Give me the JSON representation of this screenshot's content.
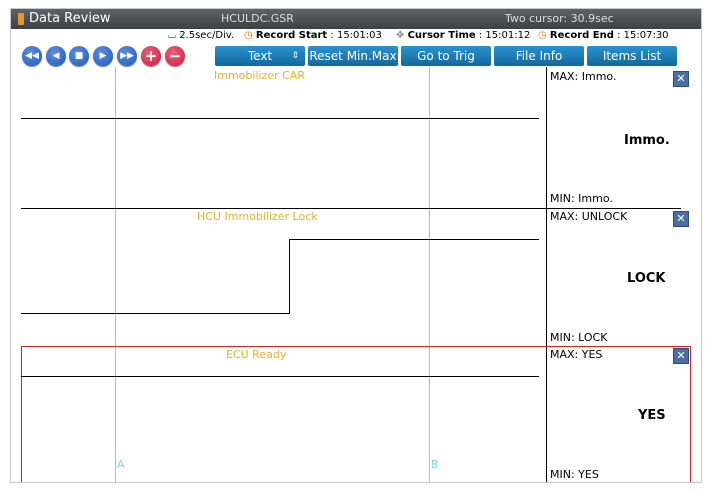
{
  "title_bar": {
    "app": "Data Review",
    "file": "HCULDC.GSR",
    "cursor_info": "Two cursor: 30.9sec"
  },
  "info_bar": {
    "div": "2.5sec/Div.",
    "record_start_label": "Record Start",
    "record_start_value": ": 15:01:03",
    "cursor_time_label": "Cursor Time",
    "cursor_time_value": ": 15:01:12",
    "record_end_label": "Record End",
    "record_end_value": ": 15:07:30"
  },
  "toolbar": {
    "nav_buttons": [
      "rewind",
      "previous",
      "stop",
      "next",
      "fast-forward"
    ],
    "zoom_buttons": [
      "+",
      "−"
    ],
    "text_select": "Text",
    "reset_label": "Reset Min.Max",
    "trig_label": "Go to Trig",
    "file_info_label": "File Info",
    "items_list_label": "Items List"
  },
  "cursors": {
    "a_label": "A",
    "b_label": "B"
  },
  "panels": [
    {
      "title": "Immobilizer CAR",
      "max": "MAX: Immo.",
      "value": "Immo.",
      "min": "MIN: Immo."
    },
    {
      "title": "HCU Immobilizer Lock",
      "max": "MAX: UNLOCK",
      "value": "LOCK",
      "min": "MIN: LOCK"
    },
    {
      "title": "ECU Ready",
      "max": "MAX: YES",
      "value": "YES",
      "min": "MIN: YES"
    }
  ],
  "colors": {
    "accent": "#1a73b8",
    "cursor": "#7fd6df",
    "title_text": "#e0b02e",
    "selected_border": "#c62828"
  }
}
